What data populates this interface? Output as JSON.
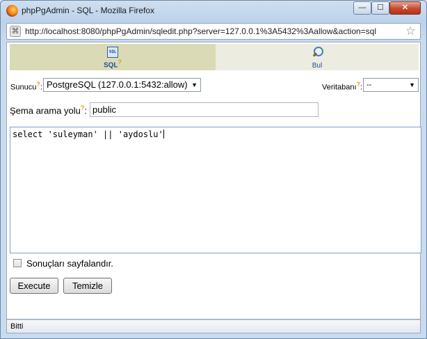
{
  "window": {
    "title": "phpPgAdmin - SQL - Mozilla Firefox",
    "minimize_glyph": "—",
    "maximize_glyph": "☐",
    "close_glyph": "✕"
  },
  "address_bar": {
    "url": "http://localhost:8080/phpPgAdmin/sqledit.php?server=127.0.0.1%3A5432%3Aallow&action=sql",
    "star_glyph": "☆"
  },
  "tabs": [
    {
      "label": "SQL",
      "help": "?",
      "icon": "sql-icon",
      "active": true
    },
    {
      "label": "Bul",
      "icon": "magnifier-icon",
      "active": false
    }
  ],
  "server": {
    "label": "Sunucu",
    "help": "?",
    "separator": ":",
    "selected": "PostgreSQL (127.0.0.1:5432:allow)"
  },
  "database": {
    "label": "Veritabanı",
    "help": "?",
    "separator": ":",
    "selected": "--"
  },
  "schema": {
    "label": "Şema arama yolu",
    "help": "?",
    "separator": ":",
    "value": "public"
  },
  "editor": {
    "text": "select 'suleyman' || 'aydoslu'"
  },
  "paginate": {
    "label": "Sonuçları sayfalandır.",
    "checked": false
  },
  "buttons": {
    "execute": "Execute",
    "reset": "Temizle"
  },
  "status": {
    "text": "Bitti"
  },
  "colors": {
    "active_tab": "#dadab6",
    "link_blue": "#1f4f99",
    "help_orange": "#e0a020"
  }
}
